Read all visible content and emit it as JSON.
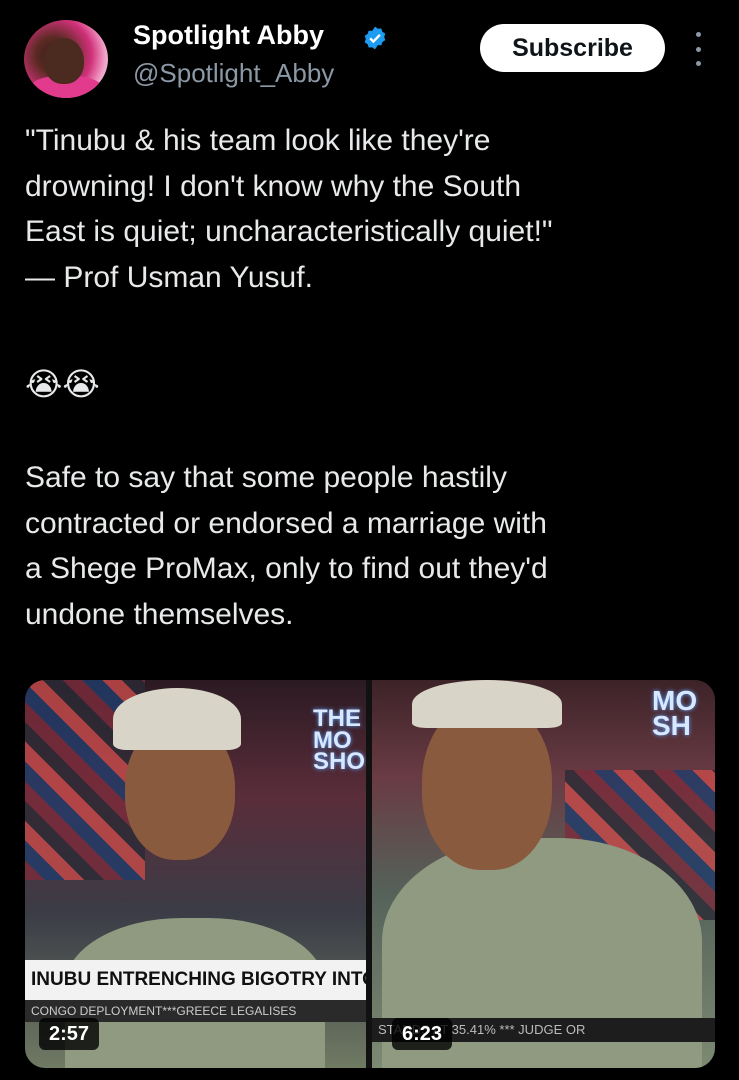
{
  "author": {
    "name": "Spotlight Abby",
    "handle": "@Spotlight_Abby",
    "verified_color": "#1d9bf0"
  },
  "actions": {
    "subscribe_label": "Subscribe",
    "more_icon": "more-vertical-icon"
  },
  "tweet": {
    "paragraph1": "\"Tinubu & his team look like they're\ndrowning! I don't know why the South\nEast is quiet; uncharacteristically quiet!\"\n— Prof Usman Yusuf.",
    "emojis": "😭😭",
    "paragraph2": "Safe to say that some people hastily\ncontracted or endorsed a marriage with\na Shege ProMax, only to find out they'd\nundone themselves."
  },
  "media": [
    {
      "logo": "THE\nMO\nSHO",
      "chyron": "INUBU ENTRENCHING BIGOTRY INTO",
      "ticker": "CONGO DEPLOYMENT***GREECE LEGALISES",
      "duration": "2:57"
    },
    {
      "logo": "MO\nSH",
      "ticker": "STANDS AT 35.41% *** JUDGE OR",
      "duration": "6:23"
    }
  ]
}
